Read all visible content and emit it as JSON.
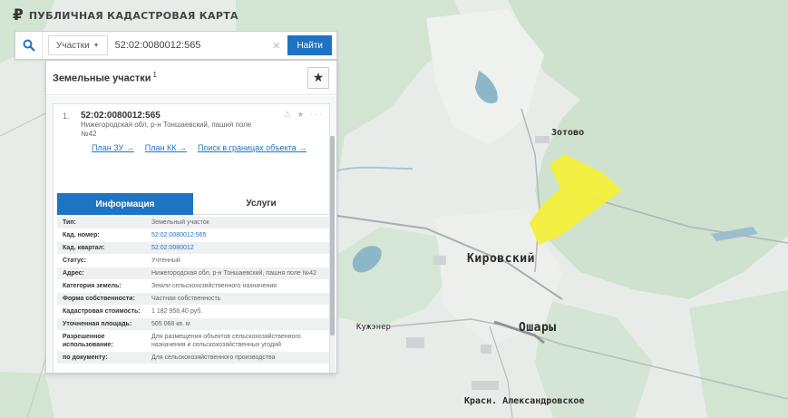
{
  "app": {
    "logo": "₽",
    "title": "ПУБЛИЧНАЯ КАДАСТРОВАЯ КАРТА"
  },
  "search": {
    "type_label": "Участки",
    "query": "52:02:0080012:565",
    "find_label": "Найти"
  },
  "panel": {
    "title": "Земельные участки",
    "title_count": "1"
  },
  "result": {
    "index": "1.",
    "cad_number": "52:02:0080012:565",
    "address": "Нижегородская обл, р-н Тоншаевский, пашня поле №42",
    "links": [
      "План ЗУ →",
      "План КК →",
      "Поиск в границах объекта →"
    ]
  },
  "tabs": [
    {
      "label": "Информация"
    },
    {
      "label": "Услуги"
    }
  ],
  "info": [
    {
      "key": "Тип:",
      "value": "Земельный участок"
    },
    {
      "key": "Кад. номер:",
      "value": "52:02:0080012:565"
    },
    {
      "key": "Кад. квартал:",
      "value": "52:02:0080012"
    },
    {
      "key": "Статус:",
      "value": "Учтенный"
    },
    {
      "key": "Адрес:",
      "value": "Нижегородская обл, р-н Тоншаевский, пашня поле №42"
    },
    {
      "key": "Категория земель:",
      "value": "Земли сельскохозяйственного назначения"
    },
    {
      "key": "Форма собственности:",
      "value": "Частная собственность"
    },
    {
      "key": "Кадастровая стоимость:",
      "value": "1 182 958,40 руб."
    },
    {
      "key": "Уточненная площадь:",
      "value": "505 068 кв. м"
    },
    {
      "key": "Разрешенное использование:",
      "value": "Для размещения объектов сельскохозяйственного назначения и сельскохозяйственных угодий"
    },
    {
      "key": "по документу:",
      "value": "Для сельскохозяйственного производства"
    }
  ],
  "map": {
    "places": {
      "zotovo": "Зотово",
      "kirovsky": "Кировский",
      "oshary": "Ошары",
      "kuzhener": "Кужэнер",
      "krasn": "Красн. Александровское"
    },
    "colors": {
      "parcel": "#f4ee3a",
      "forest": "#cfe3cf",
      "water": "#8eb6c9",
      "accent": "#1e73c3"
    }
  }
}
